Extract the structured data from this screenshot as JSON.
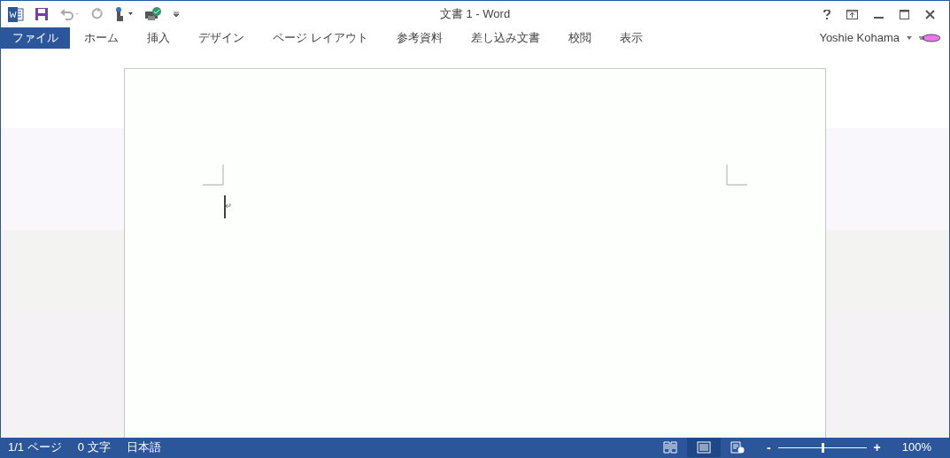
{
  "window": {
    "title": "文書 1 - Word"
  },
  "tabs": [
    {
      "label": "ファイル",
      "kind": "file"
    },
    {
      "label": "ホーム",
      "kind": "tab"
    },
    {
      "label": "挿入",
      "kind": "tab"
    },
    {
      "label": "デザイン",
      "kind": "tab"
    },
    {
      "label": "ページ レイアウト",
      "kind": "tab"
    },
    {
      "label": "参考資料",
      "kind": "tab"
    },
    {
      "label": "差し込み文書",
      "kind": "tab"
    },
    {
      "label": "校閲",
      "kind": "tab"
    },
    {
      "label": "表示",
      "kind": "tab"
    }
  ],
  "user": {
    "name": "Yoshie Kohama"
  },
  "status_bar": {
    "items": [
      "1/1 ページ",
      "0 文字",
      "日本語"
    ],
    "views": [
      {
        "kind": "read",
        "selected": false
      },
      {
        "kind": "print",
        "selected": true
      },
      {
        "kind": "web",
        "selected": false
      }
    ],
    "zoom": {
      "level": 0.5,
      "minus": "-",
      "plus": "+",
      "reading": "100%"
    }
  }
}
